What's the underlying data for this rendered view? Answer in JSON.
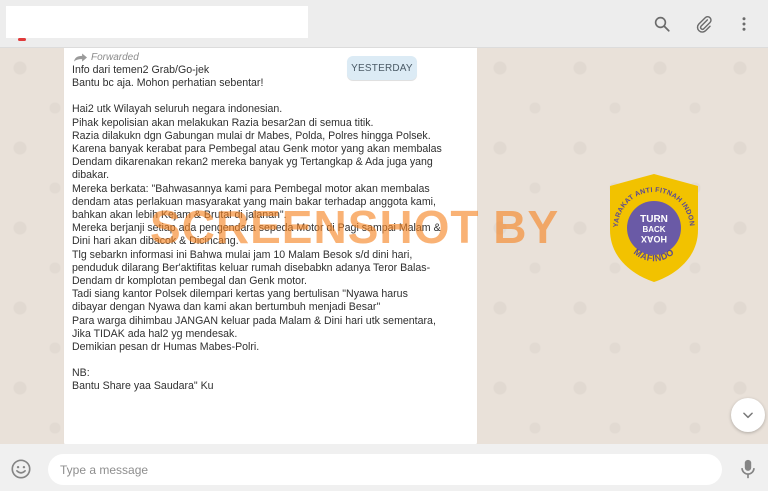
{
  "header": {
    "contact_name": "",
    "icons": [
      "search-icon",
      "attach-icon",
      "menu-icon"
    ]
  },
  "date_chip": "YESTERDAY",
  "message": {
    "forwarded_label": "Forwarded",
    "lines": [
      "Info dari temen2 Grab/Go-jek",
      "Bantu bc aja. Mohon perhatian sebentar!",
      "",
      "Hai2 utk Wilayah seluruh negara indonesian.",
      "Pihak kepolisian akan melakukan Razia besar2an di semua titik.",
      "Razia dilakukn dgn Gabungan mulai dr Mabes, Polda, Polres hingga Polsek.",
      "Karena banyak kerabat para Pembegal atau Genk motor yang akan membalas",
      "Dendam dikarenakan rekan2 mereka banyak yg Tertangkap & Ada juga yang",
      "dibakar.",
      "Mereka berkata: \"Bahwasannya kami para Pembegal motor akan membalas",
      "dendam atas perlakuan masyarakat yang main bakar terhadap anggota kami,",
      "bahkan akan lebih Kejam & Brutal di jalanan\".",
      "Mereka berjanji setiap ada pengendara sepeda Motor di Pagi sampai Malam &",
      "Dini hari akan dibacok & Dicincang.",
      "Tlg sebarkn informasi ini Bahwa mulai jam 10 Malam Besok s/d dini hari,",
      "penduduk dilarang Ber'aktifitas keluar rumah disebabkn adanya Teror Balas-",
      "Dendam dr komplotan pembegal dan Genk motor.",
      "Tadi siang kantor Polsek dilempari kertas yang bertulisan \"Nyawa harus",
      "dibayar dengan Nyawa dan kami akan bertumbuh menjadi Besar\"",
      "Para warga dihimbau JANGAN keluar pada Malam & Dini hari utk sementara,",
      "Jika TIDAK ada hal2 yg mendesak.",
      "Demikian pesan dr Humas Mabes-Polri.",
      "",
      "NB:",
      "Bantu Share yaa Saudara\" Ku"
    ]
  },
  "watermark": "SCREENSHOT BY",
  "seal": {
    "ring_top": "MASYARAKAT ANTI FITNAH INDONESIA",
    "ring_bottom": "MAFINDO",
    "center_lines": [
      "TURN",
      "BACK",
      "HOAX"
    ],
    "colors": {
      "ring": "#f2c200",
      "center": "#6a5aa6"
    }
  },
  "composer": {
    "placeholder": "Type a message",
    "value": ""
  }
}
